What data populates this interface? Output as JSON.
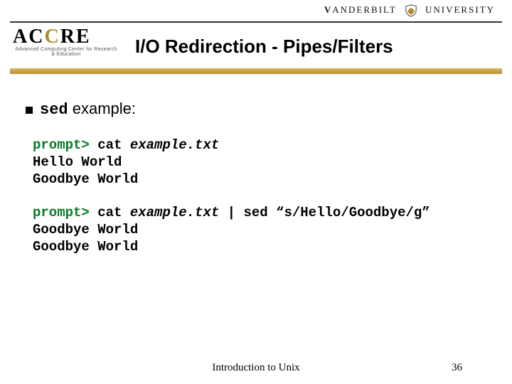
{
  "header": {
    "university_prefix": "V",
    "university_rest": "ANDERBILT",
    "university_suffix": "UNIVERSITY",
    "logo_main_a": "AC",
    "logo_main_b": "C",
    "logo_main_c": "RE",
    "logo_sub": "Advanced Computing Center\nfor Research & Education"
  },
  "title": "I/O Redirection - Pipes/Filters",
  "bullet": {
    "cmd": "sed",
    "rest": " example:"
  },
  "block1": {
    "prompt": "prompt>",
    "cmd": " cat ",
    "arg": "example.txt",
    "out1": "Hello World",
    "out2": "Goodbye World"
  },
  "block2": {
    "prompt": "prompt>",
    "cmd": " cat ",
    "arg": "example.txt",
    "pipe": " | sed “s/Hello/Goodbye/g”",
    "out1": "Goodbye World",
    "out2": "Goodbye World"
  },
  "footer": {
    "text": "Introduction to Unix",
    "page": "36"
  }
}
